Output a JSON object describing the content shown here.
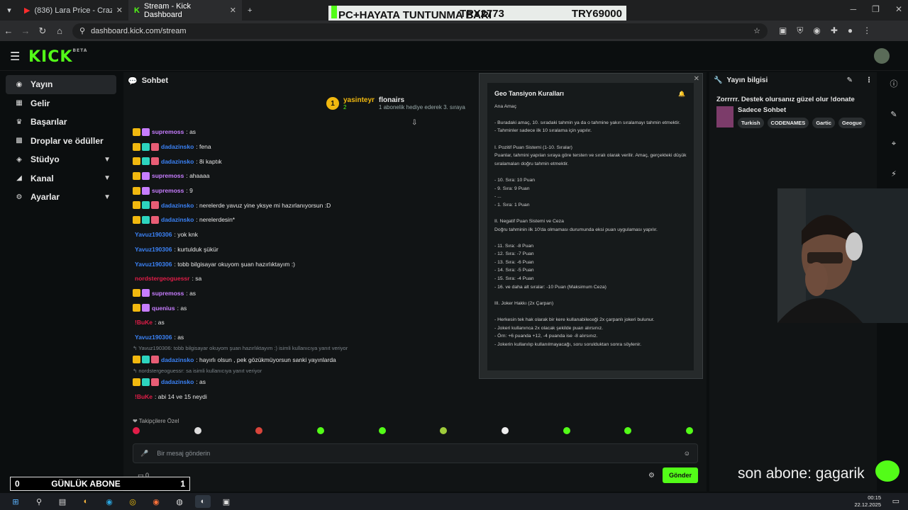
{
  "browser": {
    "tabs": [
      {
        "title": "(836) Lara Price - Crazy - YouTu",
        "active": false
      },
      {
        "title": "Stream - Kick Dashboard",
        "active": true
      }
    ],
    "url": "dashboard.kick.com/stream"
  },
  "overlay_top": {
    "left": "PC+HAYATA TUNTUNMA BARI",
    "mid": "TRY2773",
    "right": "TRY69000"
  },
  "sidebar": {
    "items": [
      {
        "label": "Yayın",
        "icon": "broadcast-icon",
        "active": true
      },
      {
        "label": "Gelir",
        "icon": "revenue-icon"
      },
      {
        "label": "Başarılar",
        "icon": "trophy-icon"
      },
      {
        "label": "Droplar ve ödüller",
        "icon": "gift-icon"
      },
      {
        "label": "Stüdyo",
        "icon": "studio-icon",
        "chevron": true
      },
      {
        "label": "Kanal",
        "icon": "channel-icon",
        "chevron": true
      },
      {
        "label": "Ayarlar",
        "icon": "gear-icon",
        "chevron": true
      }
    ]
  },
  "chat": {
    "title": "Sohbet",
    "pinned": {
      "user": "yasinteyr",
      "count": "2",
      "gifter": "flonairs",
      "text": "1 abonelik hediye ederek 3. sıraya"
    },
    "messages": [
      {
        "user": "supremoss",
        "text": ": as",
        "color": "#c77dff"
      },
      {
        "user": "dadazinsko",
        "text": ": fena",
        "color": "#3b82f6"
      },
      {
        "user": "dadazinsko",
        "text": ": 8i kaptık",
        "color": "#3b82f6"
      },
      {
        "user": "supremoss",
        "text": ": ahaaaa",
        "color": "#c77dff"
      },
      {
        "user": "supremoss",
        "text": ": 9",
        "color": "#c77dff"
      },
      {
        "user": "dadazinsko",
        "text": ": nerelerde yavuz yine yksye mi hazırlanıyorsun :D",
        "color": "#3b82f6"
      },
      {
        "user": "dadazinsko",
        "text": ": nerelerdesin*",
        "color": "#3b82f6"
      },
      {
        "user": "Yavuz190306",
        "text": ": yok knk",
        "color": "#3b82f6"
      },
      {
        "user": "Yavuz190306",
        "text": ": kurtulduk şükür",
        "color": "#3b82f6"
      },
      {
        "user": "Yavuz190306",
        "text": ": tobb bilgisayar okuyom şuan hazırlıktayım :)",
        "color": "#3b82f6"
      },
      {
        "user": "nordstergeoguessr",
        "text": ": sa",
        "color": "#e11d48"
      },
      {
        "user": "supremoss",
        "text": ": as",
        "color": "#c77dff"
      },
      {
        "user": "quenius",
        "text": ": as",
        "color": "#c77dff"
      },
      {
        "user": "!BuKe",
        "text": ": as",
        "color": "#e11d48"
      },
      {
        "user": "Yavuz190306",
        "text": ": as",
        "color": "#3b82f6"
      }
    ],
    "reply1": "↰ Yavuz190306: tobb bilgisayar okuyom şuan hazırlıktayım :) isimli kullanıcıya yanıt veriyor",
    "msg_after_reply1": {
      "user": "dadazinsko",
      "text": ": hayırlı olsun , pek gözükmüyorsun sanki yayınlarda",
      "color": "#3b82f6"
    },
    "reply2": "↰ nordstergeoguessr: sa isimli kullanıcıya yanıt veriyor",
    "msg_after_reply2": {
      "user": "dadazinsko",
      "text": ": as",
      "color": "#3b82f6"
    },
    "last": {
      "user": "!BuKe",
      "text": ": abi 14 ve 15 neydi",
      "color": "#e11d48"
    },
    "followers_label": "❤ Takipçilere Özel",
    "input_placeholder": "Bir mesaj gönderin",
    "points": "0",
    "send_label": "Gönder"
  },
  "popup": {
    "title": "Geo Tansiyon Kuralları",
    "lines": [
      "Ana Amaç",
      "",
      "- Buradaki amaç, 10. sıradaki tahmin ya da o tahmine yakın sıralamayı tahmin etmektir.",
      "- Tahminler sadece ilk 10 sıralama için yapılır.",
      "",
      "I. Pozitif Puan Sistemi (1-10. Sıralar)",
      "Puanlar, tahmini yapılan sıraya göre tersten ve sıralı olarak verilir. Amaç, gerçekteki düşük sıralamaları doğru tahmin etmektir.",
      "",
      "- 10. Sıra: 10 Puan",
      "- 9. Sıra: 9 Puan",
      "- ...",
      "- 1. Sıra: 1 Puan",
      "",
      "II. Negatif Puan Sistemi ve Ceza",
      "Doğru tahminin ilk 10'da olmaması durumunda eksi puan uygulaması yapılır.",
      "",
      "- 11. Sıra: -8 Puan",
      "- 12. Sıra: -7 Puan",
      "- 13. Sıra: -6 Puan",
      "- 14. Sıra: -5 Puan",
      "- 15. Sıra: -4 Puan",
      "- 16. ve daha alt sıralar: -10 Puan (Maksimum Ceza)",
      "",
      "III. Joker Hakkı (2x Çarpan)",
      "",
      "- Herkesin tek hak olarak bir kere kullanabileceği 2x çarpanlı jokeri bulunur.",
      "- Jokeri kullanınca 2x olacak şekilde puan alırsınız.",
      "- Örn: +6 puanda +12, -4 puanda ise -8 alırsınız.",
      "- Jokerin kullanılıp kullanılmayacağı, soru sorulduktan sonra söylenir."
    ]
  },
  "stream_info": {
    "header": "Yayın bilgisi",
    "title": "Zorrrrr. Destek olursanız güzel olur !donate",
    "category": "Sadece Sohbet",
    "tags": [
      "Turkish",
      "CODENAMES",
      "Gartic",
      "Geogue"
    ]
  },
  "overlay": {
    "sub_text": "son abone: gagarik",
    "counter_left": "0",
    "counter_label": "GÜNLÜK ABONE",
    "counter_right": "1"
  },
  "taskbar": {
    "time": "00:15",
    "date": "22.12.2025"
  }
}
